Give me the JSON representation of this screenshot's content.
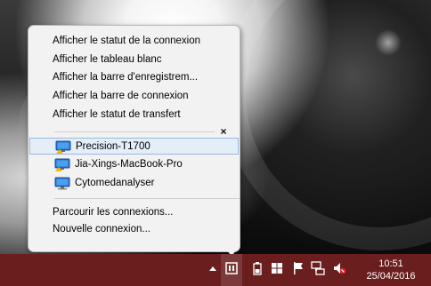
{
  "menu": {
    "actions": [
      {
        "label": "Afficher le statut de la connexion"
      },
      {
        "label": "Afficher le tableau blanc"
      },
      {
        "label": "Afficher la barre d'enregistrem..."
      },
      {
        "label": "Afficher la barre de connexion"
      },
      {
        "label": "Afficher le statut de transfert"
      }
    ],
    "close_glyph": "×",
    "connections": [
      {
        "label": "Precision-T1700",
        "selected": true,
        "icon": "monitor-icon",
        "status_color": "#f6b400"
      },
      {
        "label": "Jia-Xings-MacBook-Pro",
        "selected": false,
        "icon": "monitor-icon",
        "status_color": "#f6b400"
      },
      {
        "label": "Cytomedanalyser",
        "selected": false,
        "icon": "monitor-icon",
        "status_color": null
      }
    ],
    "footer": [
      {
        "label": "Parcourir les connexions..."
      },
      {
        "label": "Nouvelle connexion..."
      }
    ]
  },
  "taskbar": {
    "color": "#6a1e1e",
    "tray_icons": [
      "chevron-up-icon",
      "remote-desktop-icon",
      "battery-icon",
      "windows-icon",
      "flag-icon",
      "network-icon",
      "volume-muted-icon"
    ],
    "clock": {
      "time": "10:51",
      "date": "25/04/2016"
    }
  }
}
